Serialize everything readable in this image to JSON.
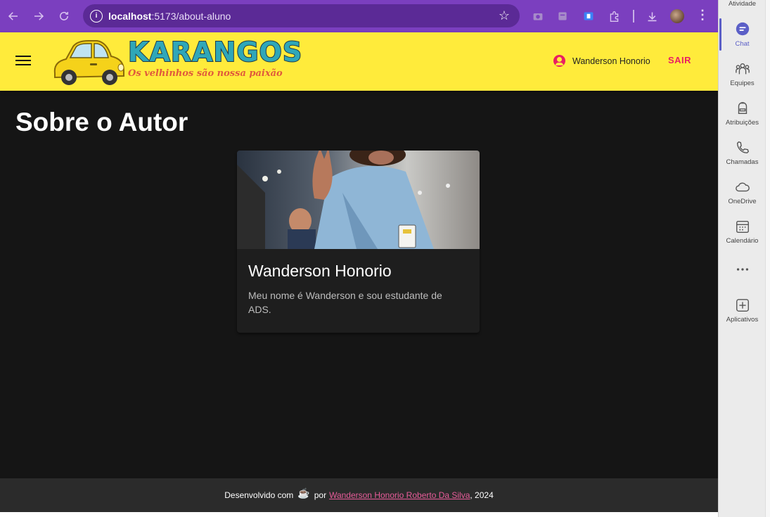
{
  "browser": {
    "url_host": "localhost",
    "url_path": ":5173/about-aluno"
  },
  "header": {
    "logo_title": "KARANGOS",
    "logo_tagline": "Os velhinhos são nossa paixão",
    "user_name": "Wanderson Honorio",
    "logout_label": "SAIR"
  },
  "main": {
    "page_title": "Sobre o Autor",
    "card": {
      "name": "Wanderson Honorio",
      "bio": "Meu nome é Wanderson e sou estudante de ADS."
    }
  },
  "footer": {
    "prefix": "Desenvolvido com",
    "middle": "por",
    "link_text": "Wanderson Honorio Roberto Da Silva",
    "suffix": ", 2024"
  },
  "teams_sidebar": {
    "items": [
      {
        "label": "Atividade",
        "icon": "bell-icon"
      },
      {
        "label": "Chat",
        "icon": "chat-icon"
      },
      {
        "label": "Equipes",
        "icon": "teams-icon"
      },
      {
        "label": "Atribuições",
        "icon": "backpack-icon"
      },
      {
        "label": "Chamadas",
        "icon": "phone-icon"
      },
      {
        "label": "OneDrive",
        "icon": "cloud-icon"
      },
      {
        "label": "Calendário",
        "icon": "calendar-icon"
      },
      {
        "label": "Aplicativos",
        "icon": "add-icon"
      }
    ]
  },
  "colors": {
    "browser_frame": "#7b3fbf",
    "header_bg": "#ffeb3b",
    "accent_pink": "#e91e63",
    "page_bg": "#151515",
    "teams_accent": "#5b5fc7"
  }
}
